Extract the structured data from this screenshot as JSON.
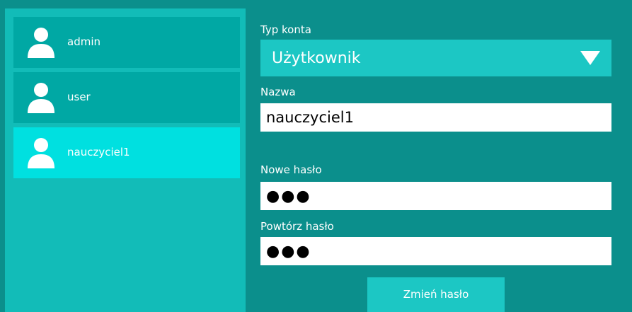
{
  "users": [
    {
      "name": "admin",
      "icon": "user-icon",
      "selected": false
    },
    {
      "name": "user",
      "icon": "user-icon",
      "selected": false
    },
    {
      "name": "nauczyciel1",
      "icon": "user-icon",
      "selected": true
    }
  ],
  "form": {
    "account_type": {
      "label": "Typ konta",
      "value": "Użytkownik",
      "icon": "triangle-down-icon"
    },
    "name": {
      "label": "Nazwa",
      "value": "nauczyciel1"
    },
    "new_password": {
      "label": "Nowe hasło",
      "value": "●●●"
    },
    "repeat_password": {
      "label": "Powtórz hasło",
      "value": "●●●"
    },
    "submit_label": "Zmień hasło"
  },
  "colors": {
    "background": "#0b8f8c",
    "sidebar": "#12bcb8",
    "user_item": "#00a8a4",
    "user_item_selected": "#00e0e0",
    "control": "#1cc7c4"
  }
}
